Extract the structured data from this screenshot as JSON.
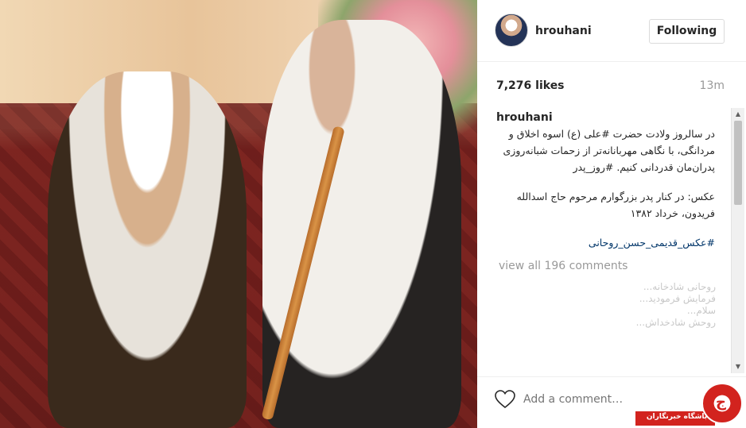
{
  "post": {
    "username": "hrouhani",
    "follow_label": "Following",
    "likes": "7,276 likes",
    "time": "13m",
    "caption_user": "hrouhani",
    "caption_lines": [
      "در سالروز ولادت حضرت #علی (ع) اسوه اخلاق و",
      "مردانگی، با نگاهی مهربانانه‌تر از زحمات شبانه‌روزی",
      "پدران‌مان قدردانی کنیم. #روز_پدر"
    ],
    "photo_lines": [
      "عکس: در کنار پدر بزرگوارم مرحوم حاج اسدالله",
      "فریدون، خرداد ۱۳۸۲"
    ],
    "hashtag_line": "#عکس_قدیمی_حسن_روحانی",
    "view_all": "view all 196 comments",
    "add_comment_placeholder": "Add a comment…"
  },
  "faded_comments": [
    "روحانی شادخانه...",
    "فرمایش فرمودید...",
    "سلام...",
    "روحش شادخداش..."
  ],
  "watermark": {
    "text": "باشگاه خبرنگاران"
  },
  "icons": {
    "heart": "heart-outline-icon",
    "scroll_up": "arrow-up-icon",
    "scroll_down": "arrow-down-icon"
  },
  "colors": {
    "hashtag": "#003569",
    "watermark_red": "#d2231e"
  }
}
